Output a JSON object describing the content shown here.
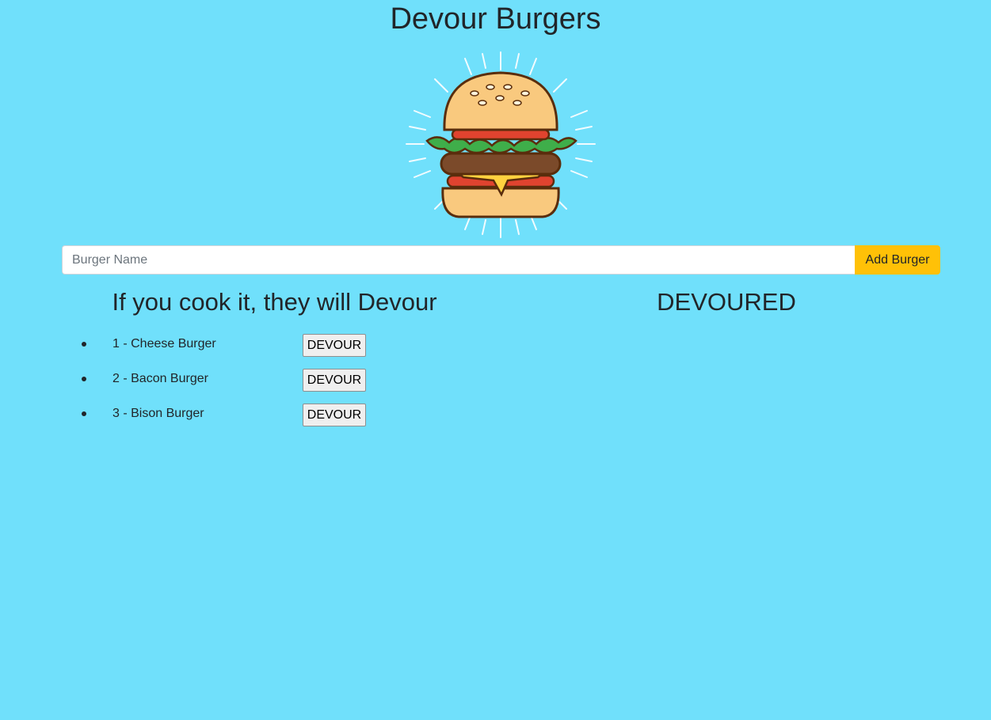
{
  "header": {
    "title": "Devour Burgers"
  },
  "logo": {
    "icon": "burger-illustration"
  },
  "add_form": {
    "input_placeholder": "Burger Name",
    "input_value": "",
    "button_label": "Add Burger"
  },
  "uneaten": {
    "heading": "If you cook it, they will Devour",
    "items": [
      {
        "label": "1 - Cheese Burger",
        "button": "DEVOUR"
      },
      {
        "label": "2 - Bacon Burger",
        "button": "DEVOUR"
      },
      {
        "label": "3 - Bison Burger",
        "button": "DEVOUR"
      }
    ]
  },
  "devoured": {
    "heading": "DEVOURED",
    "items": []
  },
  "colors": {
    "background": "#70e0fb",
    "accent": "#ffc107",
    "text": "#212529"
  }
}
